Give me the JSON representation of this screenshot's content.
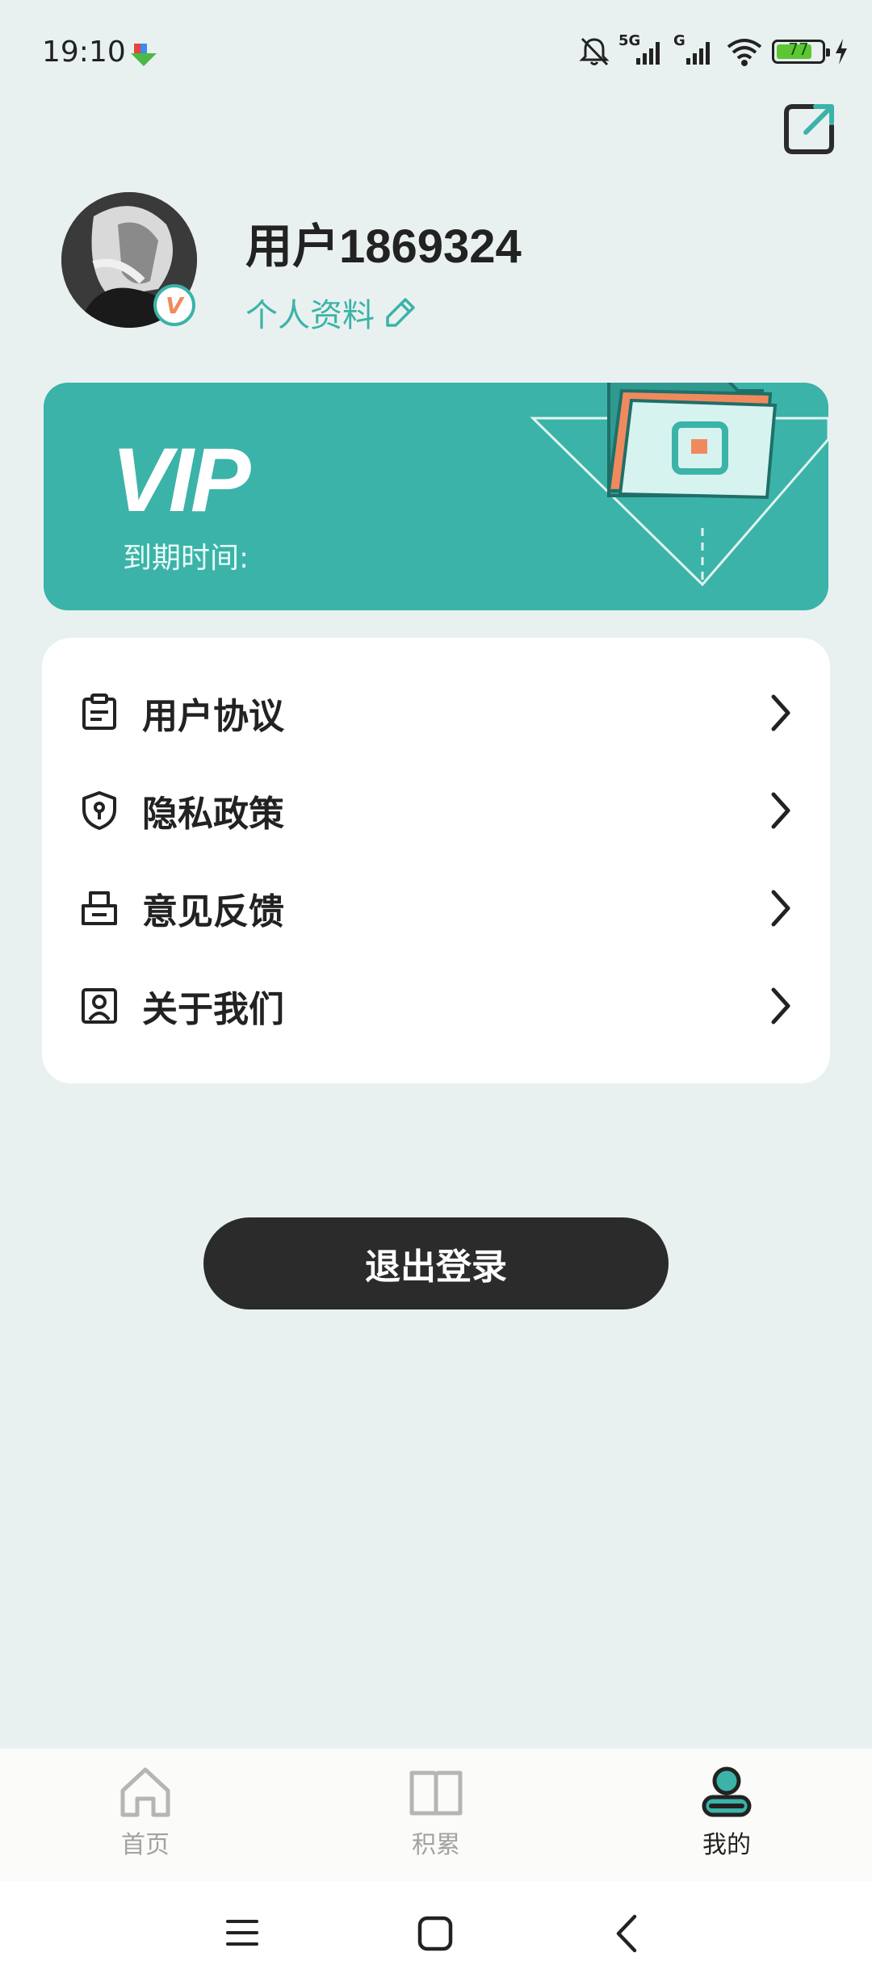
{
  "status_bar": {
    "time": "19:10",
    "network_1": "5G",
    "network_2": "G",
    "battery": "77"
  },
  "profile": {
    "username": "用户1869324",
    "edit_link": "个人资料",
    "badge": "V"
  },
  "vip_card": {
    "title": "VIP",
    "expiry_label": "到期时间:"
  },
  "menu": [
    {
      "label": "用户协议",
      "icon": "document-icon"
    },
    {
      "label": "隐私政策",
      "icon": "shield-icon"
    },
    {
      "label": "意见反馈",
      "icon": "feedback-box-icon"
    },
    {
      "label": "关于我们",
      "icon": "contact-card-icon"
    }
  ],
  "logout_label": "退出登录",
  "bottom_nav": [
    {
      "label": "首页",
      "icon": "home-icon",
      "active": false
    },
    {
      "label": "积累",
      "icon": "book-icon",
      "active": false
    },
    {
      "label": "我的",
      "icon": "person-icon",
      "active": true
    }
  ],
  "colors": {
    "accent": "#3bb3a8",
    "background": "#e9f1f0",
    "dark_button": "#2b2b2b",
    "orange": "#f08a5d"
  }
}
